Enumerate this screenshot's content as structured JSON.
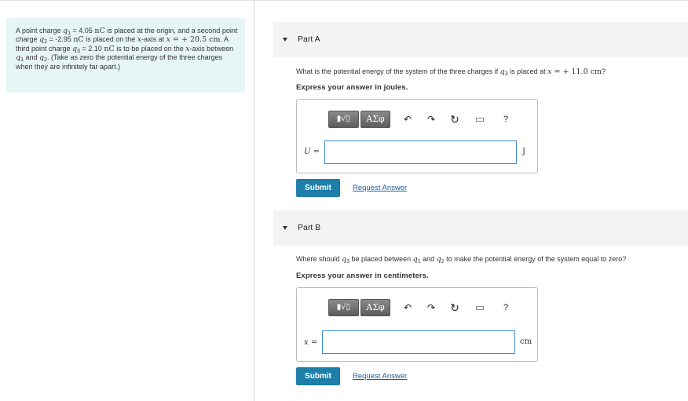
{
  "problem": {
    "s1": "A point charge ",
    "q1_sym": "q",
    "q1_sub": "1",
    "s2": " = 4.05 ",
    "u1": "nC",
    "s3": " is placed at the origin, and a second point charge ",
    "q2_sym": "q",
    "q2_sub": "2",
    "s4": " = -2.95 ",
    "u2": "nC",
    "s5": " is placed on the ",
    "x1": "x",
    "s6": "-axis at ",
    "x2": "x",
    "s7": " = + 20.5 ",
    "u3": "cm",
    "s8": ". A third point charge ",
    "q3_sym": "q",
    "q3_sub": "3",
    "s9": " = 2.10 ",
    "u4": "nC",
    "s10": " is to be placed on the ",
    "x3": "x",
    "s11": "-axis between ",
    "q1b_sym": "q",
    "q1b_sub": "1",
    "s12": " and ",
    "q2b_sym": "q",
    "q2b_sub": "2",
    "s13": ". (Take as zero the potential energy of the three charges when they are infinitely far apart.)"
  },
  "toolbar": {
    "template_label": "▮√▯",
    "greek_label": "ΑΣφ",
    "undo_glyph": "↶",
    "redo_glyph": "↷",
    "reset_glyph": "↻",
    "keyboard_glyph": "▭",
    "help_glyph": "?"
  },
  "partA": {
    "title": "Part A",
    "q_text1": "What is the potential energy of the system of the three charges if ",
    "q_sym": "q",
    "q_sub": "3",
    "q_text2": " is placed at ",
    "q_x": "x",
    "q_eq": " = + 11.0 ",
    "q_unit": "cm",
    "q_end": "?",
    "instruction": "Express your answer in joules.",
    "var_label": "U =",
    "input_value": "",
    "unit": "J",
    "submit_label": "Submit",
    "request_label": "Request Answer"
  },
  "partB": {
    "title": "Part B",
    "q_text1": "Where should ",
    "q_sym": "q",
    "q_sub": "3",
    "q_text2": " be placed between ",
    "q1_sym": "q",
    "q1_sub": "1",
    "q_and": " and ",
    "q2_sym": "q",
    "q2_sub": "2",
    "q_text3": " to make the potential energy of the system equal to zero?",
    "instruction": "Express your answer in centimeters.",
    "var_label": "x =",
    "input_value": "",
    "unit": "cm",
    "submit_label": "Submit",
    "request_label": "Request Answer"
  },
  "colors": {
    "problem_bg": "#e8f5f7",
    "submit_bg": "#1d7fa8",
    "link": "#1a5c96",
    "input_border": "#3f8fd6"
  }
}
